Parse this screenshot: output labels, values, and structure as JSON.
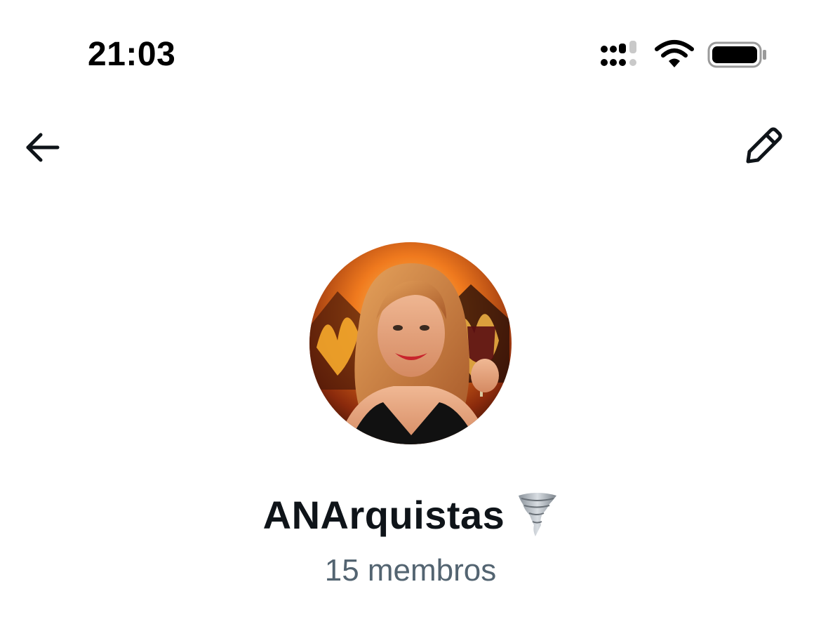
{
  "status_bar": {
    "time": "21:03",
    "icons": [
      "cellular-signal-icon",
      "wifi-icon",
      "battery-icon"
    ]
  },
  "nav": {
    "back_icon": "arrow-left-icon",
    "edit_icon": "pencil-icon"
  },
  "group": {
    "name": "ANArquistas",
    "emoji_icon": "tornado-icon",
    "member_count": "15 membros"
  },
  "colors": {
    "text_primary": "#0f1419",
    "text_secondary": "#536471",
    "background": "#ffffff"
  }
}
